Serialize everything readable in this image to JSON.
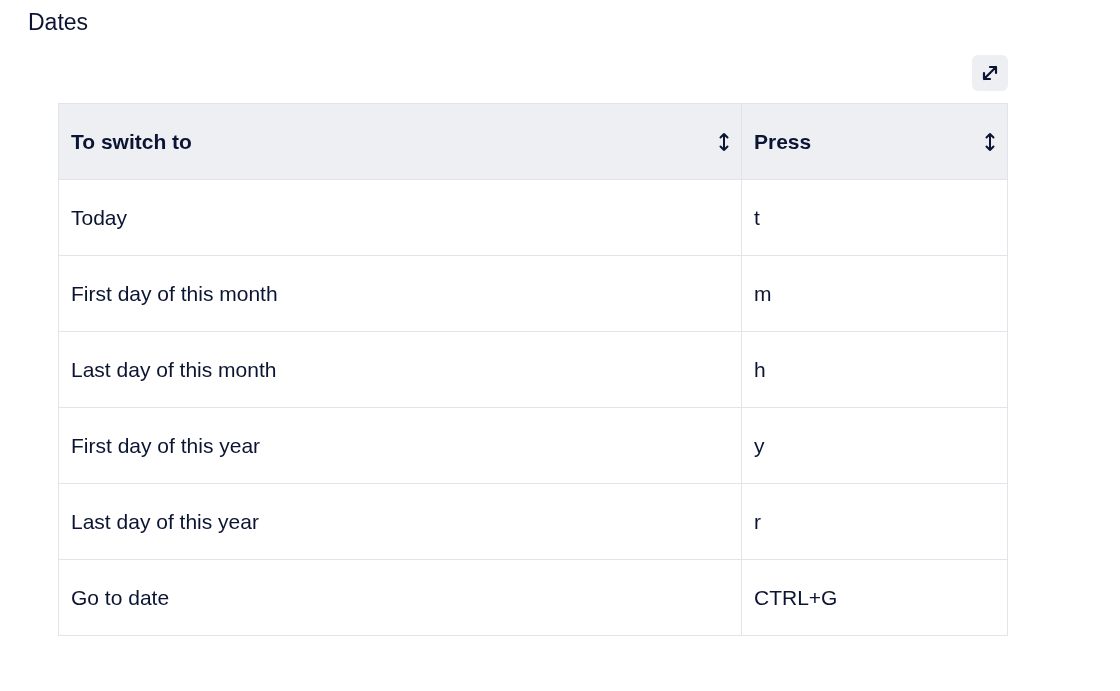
{
  "heading": "Dates",
  "table": {
    "columns": [
      "To switch to",
      "Press"
    ],
    "rows": [
      [
        "Today",
        "t"
      ],
      [
        "First day of this month",
        "m"
      ],
      [
        "Last day of this month",
        "h"
      ],
      [
        "First day of this year",
        "y"
      ],
      [
        "Last day of this year",
        "r"
      ],
      [
        "Go to date",
        "CTRL+G"
      ]
    ]
  }
}
